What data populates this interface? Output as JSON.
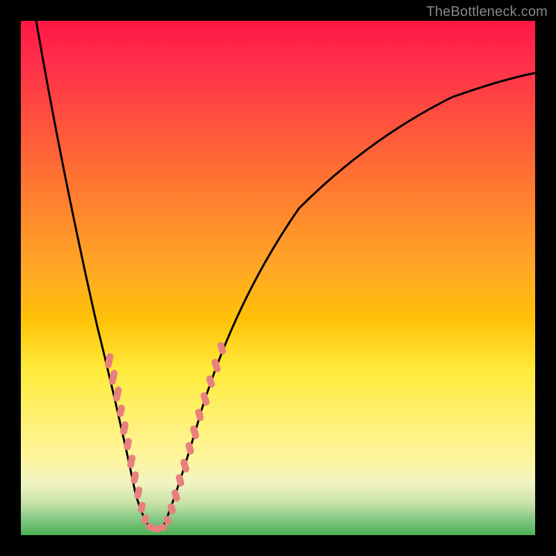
{
  "watermark": "TheBottleneck.com",
  "chart_data": {
    "type": "line",
    "title": "",
    "xlabel": "",
    "ylabel": "",
    "xlim": [
      0,
      100
    ],
    "ylim": [
      0,
      100
    ],
    "grid": false,
    "legend": false,
    "notes": "Bottleneck-style curve: a black V-shaped curve plunging from top-left, reaching a minimum around x≈25 (near the bottom green band), then rising back toward upper-right. Background is a vertical gradient from red (top) through orange/yellow to green (bottom). Pale-red dotted markers trace the curve near the trough on both branches.",
    "series": [
      {
        "name": "bottleneck-curve",
        "x": [
          3,
          6,
          9,
          12,
          15,
          17,
          19,
          20,
          21.5,
          23,
          25,
          27,
          28.5,
          30,
          32,
          34,
          37,
          42,
          50,
          60,
          72,
          85,
          97
        ],
        "y": [
          100,
          85,
          70,
          56,
          44,
          36,
          28,
          20,
          12,
          6,
          2,
          5,
          10,
          16,
          24,
          32,
          40,
          52,
          64,
          74,
          82,
          88,
          92
        ]
      },
      {
        "name": "trough-markers-left",
        "x": [
          17,
          17.8,
          18.6,
          19.2,
          19.8,
          20.4,
          21.0,
          21.6,
          22.2,
          22.8,
          23.4,
          24.0
        ],
        "y": [
          35,
          31,
          27,
          24,
          20,
          17,
          14,
          11,
          8,
          6,
          4,
          3
        ]
      },
      {
        "name": "trough-markers-right",
        "x": [
          26.0,
          26.6,
          27.2,
          27.8,
          28.4,
          29.0,
          29.6,
          30.2,
          30.8,
          31.4,
          32.0,
          32.6
        ],
        "y": [
          3,
          5,
          8,
          11,
          14,
          17,
          20,
          24,
          27,
          30,
          33,
          35
        ]
      }
    ],
    "gradient_stops": [
      {
        "pos": 0,
        "color": "#ff1744"
      },
      {
        "pos": 8,
        "color": "#ff2e4a"
      },
      {
        "pos": 18,
        "color": "#ff4d3f"
      },
      {
        "pos": 28,
        "color": "#ff6b35"
      },
      {
        "pos": 38,
        "color": "#ff8a2b"
      },
      {
        "pos": 48,
        "color": "#ffa726"
      },
      {
        "pos": 58,
        "color": "#ffc107"
      },
      {
        "pos": 68,
        "color": "#ffeb3b"
      },
      {
        "pos": 78,
        "color": "#fff176"
      },
      {
        "pos": 85,
        "color": "#fff59d"
      },
      {
        "pos": 90,
        "color": "#f0f4c3"
      },
      {
        "pos": 94,
        "color": "#c5e1a5"
      },
      {
        "pos": 97,
        "color": "#81c784"
      },
      {
        "pos": 100,
        "color": "#4caf50"
      }
    ],
    "colors": {
      "curve": "#000000",
      "markers": "#e8817e",
      "frame": "#000000"
    }
  }
}
